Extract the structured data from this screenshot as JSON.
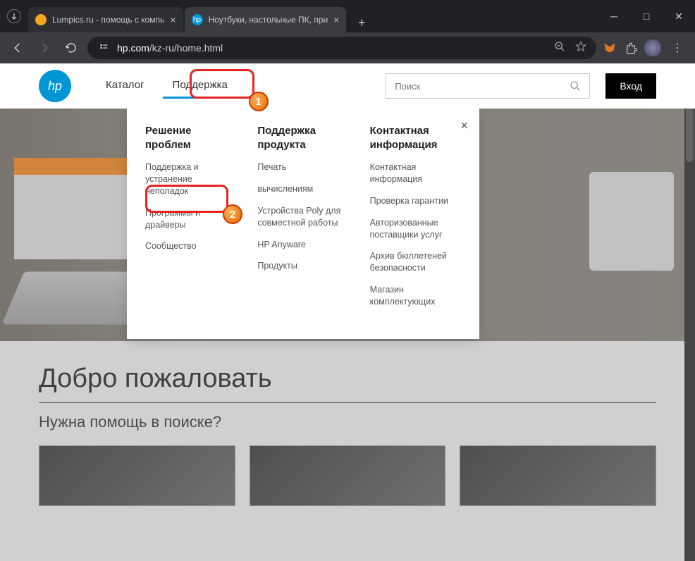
{
  "browser": {
    "tabs": [
      {
        "title": "Lumpics.ru - помощь с компь"
      },
      {
        "title": "Ноутбуки, настольные ПК, при"
      }
    ],
    "url_domain": "hp.com",
    "url_path": "/kz-ru/home.html"
  },
  "hp_header": {
    "logo_text": "hp",
    "nav": {
      "catalog": "Каталог",
      "support": "Поддержка"
    },
    "search_placeholder": "Поиск",
    "login": "Вход"
  },
  "dropdown": {
    "col1": {
      "title": "Решение проблем",
      "items": [
        "Поддержка и устранение неполадок",
        "Программы и драйверы",
        "Сообщество"
      ]
    },
    "col2": {
      "title": "Поддержка продукта",
      "items": [
        "Печать",
        "вычислениям",
        "Устройства Poly для совместной работы",
        "HP Anyware",
        "Продукты"
      ]
    },
    "col3": {
      "title": "Контактная информация",
      "items": [
        "Контактная информация",
        "Проверка гарантии",
        "Авторизованные поставщики услуг",
        "Архив бюллетеней безопасности",
        "Магазин комплектующих"
      ]
    }
  },
  "annotations": {
    "b1": "1",
    "b2": "2"
  },
  "welcome": {
    "h1": "Добро пожаловать",
    "h2": "Нужна помощь в поиске?"
  }
}
